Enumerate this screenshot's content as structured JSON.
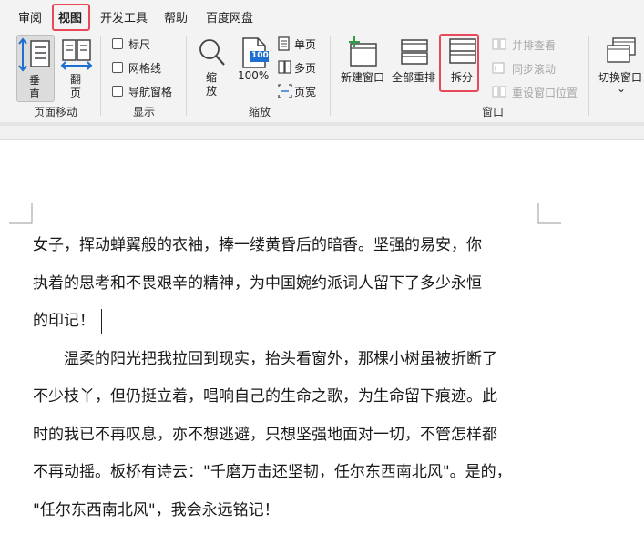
{
  "tabs": [
    "审阅",
    "视图",
    "开发工具",
    "帮助",
    "百度网盘"
  ],
  "ribbon": {
    "page_move": {
      "vertical_label_1": "垂",
      "vertical_label_2": "直",
      "flip_label_1": "翻",
      "flip_label_2": "页",
      "group_label": "页面移动"
    },
    "show": {
      "ruler": "标尺",
      "gridlines": "网格线",
      "nav_pane": "导航窗格",
      "group_label": "显示"
    },
    "zoom": {
      "zoom_label_1": "缩",
      "zoom_label_2": "放",
      "percent_label": "100%",
      "percent_icon_text": "100",
      "single_page": "单页",
      "multi_page": "多页",
      "page_width": "页宽",
      "group_label": "缩放"
    },
    "window": {
      "new_window": "新建窗口",
      "arrange_all": "全部重排",
      "split": "拆分",
      "side_by_side": "并排查看",
      "sync_scroll": "同步滚动",
      "reset_position": "重设窗口位置",
      "group_label": "窗口"
    },
    "switch_window": {
      "label": "切换窗口",
      "chevron": "⌄"
    }
  },
  "document": {
    "lines": [
      "女子，挥动蝉翼般的衣袖，捧一缕黄昏后的暗香。坚强的易安，你",
      "执着的思考和不畏艰辛的精神，为中国婉约派词人留下了多少永恒",
      "的印记！",
      "　　温柔的阳光把我拉回到现实，抬头看窗外，那棵小树虽被折断了",
      "不少枝丫，但仍挺立着，唱响自己的生命之歌，为生命留下痕迹。此",
      "时的我已不再叹息，亦不想逃避，只想坚强地面对一切，不管怎样都",
      "不再动摇。板桥有诗云：\"千磨万击还坚韧，任尔东西南北风\"。是的，",
      "\"任尔东西南北风\"，我会永远铭记！"
    ]
  },
  "colors": {
    "highlight_box": "#e8485a",
    "ribbon_bg": "#f3f3f3",
    "accent_blue": "#1e6fd0"
  }
}
